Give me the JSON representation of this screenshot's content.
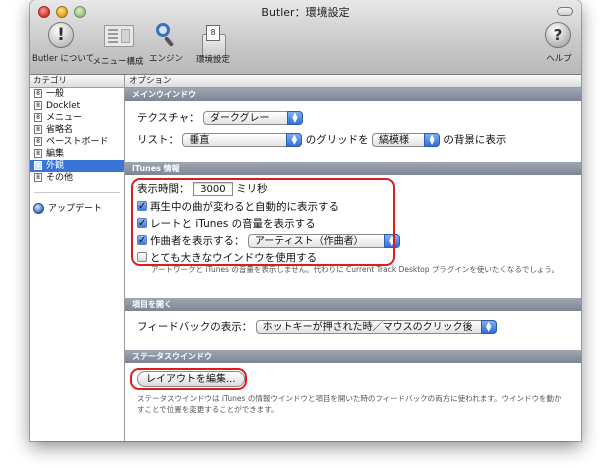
{
  "window": {
    "title": "Butler：環境設定"
  },
  "toolbar": {
    "about_label": "Butler について",
    "menu_label": "メニュー構成",
    "engine_label": "エンジン",
    "prefs_label": "環境設定",
    "help_label": "ヘルプ"
  },
  "sidebar": {
    "header": "カテゴリ",
    "items": [
      {
        "label": "一般"
      },
      {
        "label": "Docklet"
      },
      {
        "label": "メニュー"
      },
      {
        "label": "省略名"
      },
      {
        "label": "ペーストボード"
      },
      {
        "label": "編集"
      },
      {
        "label": "外観",
        "selected": true
      },
      {
        "label": "その他"
      }
    ],
    "update_label": "アップデート"
  },
  "main": {
    "header": "オプション",
    "main_window": {
      "title": "メインウインドウ",
      "texture_label": "テクスチャ：",
      "texture_value": "ダークグレー",
      "list_label": "リスト：",
      "list_value": "垂直",
      "grid_label": "のグリッドを",
      "grid_value": "縞模様",
      "background_label": "の背景に表示"
    },
    "itunes": {
      "title": "iTunes 情報",
      "display_time_label": "表示時間：",
      "display_time_value": "3000",
      "display_time_unit": "ミリ秒",
      "auto_show_label": "再生中の曲が変わると自動的に表示する",
      "rating_volume_label": "レートと iTunes の音量を表示する",
      "composer_label": "作曲者を表示する：",
      "composer_value": "アーティスト（作曲者）",
      "large_window_label": "とても大きなウインドウを使用する",
      "note": "アートワークと iTunes の音量を表示しません。代わりに Current Track Desktop プラグインを使いたくなるでしょう。"
    },
    "open_item": {
      "title": "項目を開く",
      "feedback_label": "フィードバックの表示：",
      "feedback_value": "ホットキーが押された時／マウスのクリック後"
    },
    "status_window": {
      "title": "ステータスウインドウ",
      "edit_layout_label": "レイアウトを編集...",
      "note": "ステータスウインドウは iTunes の情報ウインドウと項目を開いた時のフィードバックの両方に使われます。ウインドウを動かすことで位置を変更することができます。"
    }
  },
  "colors": {
    "selection": "#3875d7",
    "highlight": "#e01b1b",
    "section": "#8a929e"
  },
  "icons": [
    "exclamation-icon",
    "menu-layout-icon",
    "magnifier-icon",
    "switch-icon",
    "help-icon",
    "update-icon"
  ]
}
